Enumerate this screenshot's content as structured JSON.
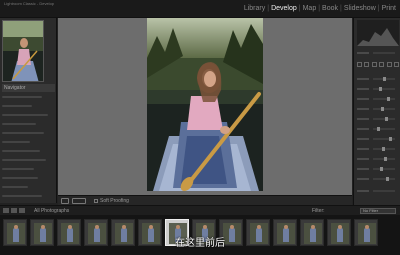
{
  "app": {
    "title": "Lightroom Classic - Develop"
  },
  "modules": [
    {
      "label": "Library",
      "active": false
    },
    {
      "label": "Develop",
      "active": true
    },
    {
      "label": "Map",
      "active": false
    },
    {
      "label": "Book",
      "active": false
    },
    {
      "label": "Slideshow",
      "active": false
    },
    {
      "label": "Print",
      "active": false
    }
  ],
  "left_panel": {
    "navigator_label": "Navigator"
  },
  "toolbar": {
    "soft_proofing_label": "Soft Proofing"
  },
  "filmstrip": {
    "source_label": "All Photographs",
    "filter_label": "Filter:",
    "filter_value": "No Filter",
    "thumbnail_count": 14,
    "selected_index": 5
  },
  "subtitle": "在这里前后",
  "colors": {
    "accent": "#e8e8e8",
    "background": "#6d6d6d",
    "panel": "#2b2b2b"
  }
}
